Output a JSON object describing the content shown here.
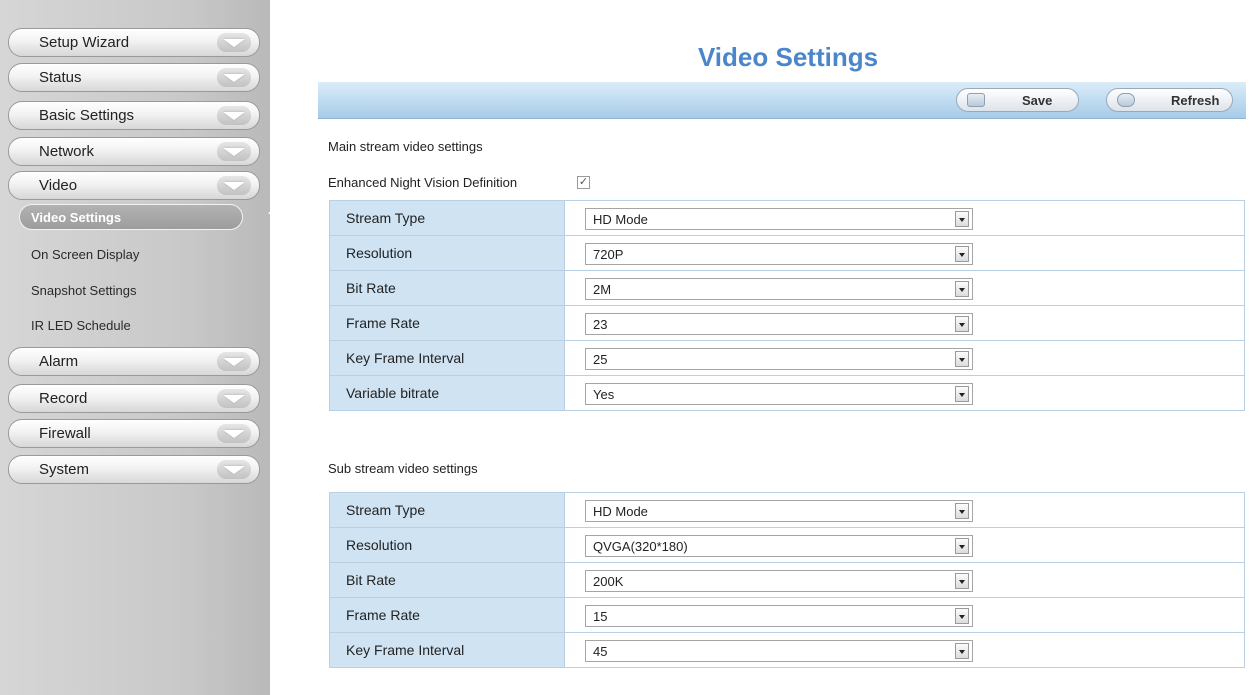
{
  "sidebar": {
    "menu": [
      {
        "label": "Setup Wizard"
      },
      {
        "label": "Status"
      },
      {
        "label": "Basic Settings"
      },
      {
        "label": "Network"
      },
      {
        "label": "Video"
      },
      {
        "label": "Alarm"
      },
      {
        "label": "Record"
      },
      {
        "label": "Firewall"
      },
      {
        "label": "System"
      }
    ],
    "video_submenu": {
      "active": "Video Settings",
      "items": [
        "On Screen Display",
        "Snapshot Settings",
        "IR LED Schedule"
      ]
    }
  },
  "page": {
    "title": "Video Settings",
    "toolbar": {
      "save_label": "Save",
      "refresh_label": "Refresh"
    }
  },
  "main_stream": {
    "heading": "Main stream video settings",
    "night_vision_label": "Enhanced Night Vision Definition",
    "night_vision_checked": true,
    "rows": [
      {
        "label": "Stream Type",
        "value": "HD Mode"
      },
      {
        "label": "Resolution",
        "value": "720P"
      },
      {
        "label": "Bit Rate",
        "value": "2M"
      },
      {
        "label": "Frame Rate",
        "value": "23"
      },
      {
        "label": "Key Frame Interval",
        "value": "25"
      },
      {
        "label": "Variable bitrate",
        "value": "Yes"
      }
    ]
  },
  "sub_stream": {
    "heading": "Sub stream video settings",
    "rows": [
      {
        "label": "Stream Type",
        "value": "HD Mode"
      },
      {
        "label": "Resolution",
        "value": "QVGA(320*180)"
      },
      {
        "label": "Bit Rate",
        "value": "200K"
      },
      {
        "label": "Frame Rate",
        "value": "15"
      },
      {
        "label": "Key Frame Interval",
        "value": "45"
      }
    ]
  },
  "colors": {
    "title": "#4a86c9",
    "toolbar": "#c0dcf1",
    "label_cell": "#cfe3f3",
    "sidebar": "#c8c8c8"
  }
}
